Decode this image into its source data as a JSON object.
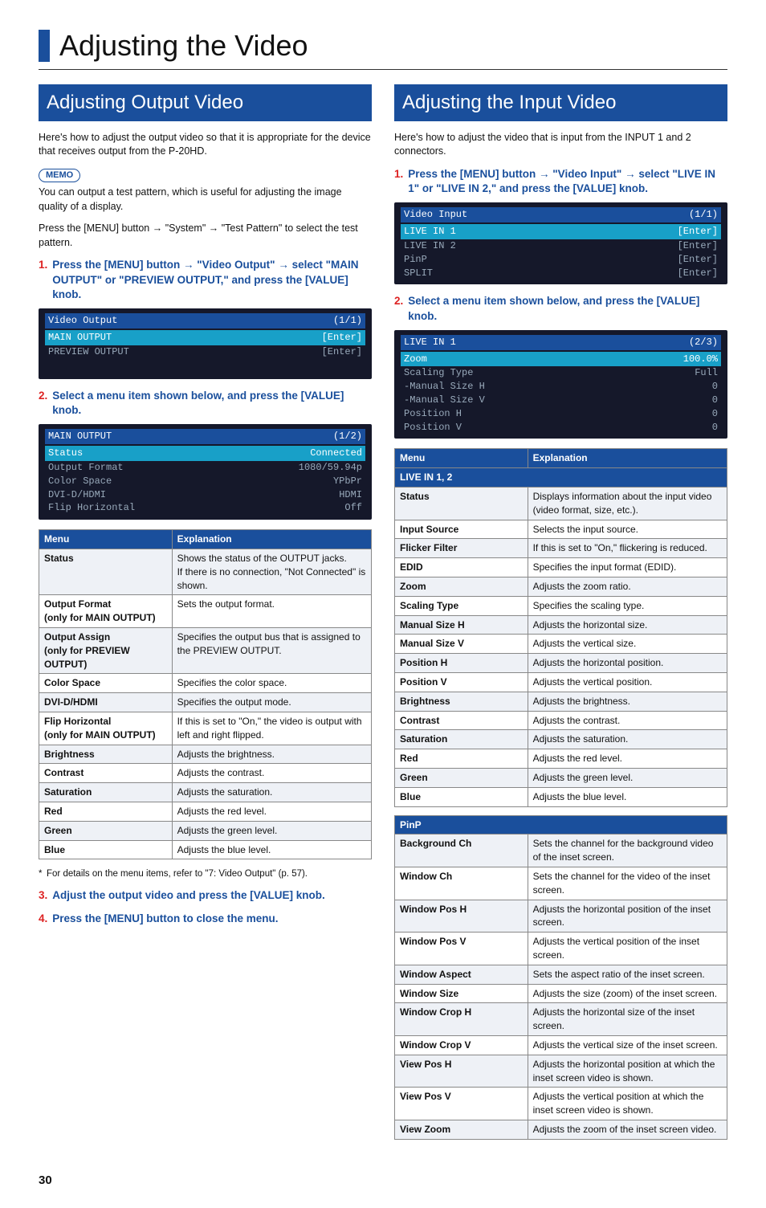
{
  "page": {
    "title": "Adjusting the Video",
    "number": "30"
  },
  "left": {
    "heading": "Adjusting Output Video",
    "intro": "Here's how to adjust the output video so that it is appropriate for the device that receives output from the P-20HD.",
    "memo_label": "MEMO",
    "memo1": "You can output a test pattern, which is useful for adjusting the image quality of a display.",
    "memo2_a": "Press the [MENU] button ",
    "memo2_b": " \"System\" ",
    "memo2_c": " \"Test Pattern\" to select the test pattern.",
    "step1_num": "1.",
    "step1_a": "Press the [MENU] button ",
    "step1_b": " \"Video Output\" ",
    "step1_c": " select \"MAIN OUTPUT\" or \"PREVIEW OUTPUT,\" and press the [VALUE] knob.",
    "osd1": {
      "title_l": "Video Output",
      "title_r": "(1/1)",
      "hl_l": "MAIN OUTPUT",
      "hl_r": "[Enter]",
      "rows": [
        [
          "PREVIEW OUTPUT",
          "[Enter]"
        ]
      ]
    },
    "step2_num": "2.",
    "step2": "Select a menu item shown below, and press the [VALUE] knob.",
    "osd2": {
      "title_l": "MAIN OUTPUT",
      "title_r": "(1/2)",
      "hl_l": "Status",
      "hl_r": "Connected",
      "rows": [
        [
          "Output Format",
          "1080/59.94p"
        ],
        [
          "Color Space",
          "YPbPr"
        ],
        [
          "DVI-D/HDMI",
          "HDMI"
        ],
        [
          "Flip Horizontal",
          "Off"
        ]
      ]
    },
    "table_head_menu": "Menu",
    "table_head_exp": "Explanation",
    "table": [
      {
        "m": "Status",
        "e": "Shows the status of the OUTPUT jacks.\nIf there is no connection, \"Not Connected\" is shown."
      },
      {
        "m": "Output Format\n(only for MAIN OUTPUT)",
        "e": "Sets the output format."
      },
      {
        "m": "Output Assign\n(only for PREVIEW OUTPUT)",
        "e": "Specifies the output bus that is assigned to the PREVIEW OUTPUT."
      },
      {
        "m": "Color Space",
        "e": "Specifies the color space."
      },
      {
        "m": "DVI-D/HDMI",
        "e": "Specifies the output mode."
      },
      {
        "m": "Flip Horizontal\n(only for MAIN OUTPUT)",
        "e": "If this is set to \"On,\" the video is output with left and right flipped."
      },
      {
        "m": "Brightness",
        "e": "Adjusts the brightness."
      },
      {
        "m": "Contrast",
        "e": "Adjusts the contrast."
      },
      {
        "m": "Saturation",
        "e": "Adjusts the saturation."
      },
      {
        "m": "Red",
        "e": "Adjusts the red level."
      },
      {
        "m": "Green",
        "e": "Adjusts the green level."
      },
      {
        "m": "Blue",
        "e": "Adjusts the blue level."
      }
    ],
    "footnote": "For details on the menu items, refer to \"7: Video Output\" (p. 57).",
    "step3_num": "3.",
    "step3": "Adjust the output video and press the [VALUE] knob.",
    "step4_num": "4.",
    "step4": "Press the [MENU] button to close the menu."
  },
  "right": {
    "heading": "Adjusting the Input Video",
    "intro": "Here's how to adjust the video that is input from the INPUT 1 and 2 connectors.",
    "step1_num": "1.",
    "step1_a": "Press the [MENU] button ",
    "step1_b": " \"Video Input\" ",
    "step1_c": " select \"LIVE IN 1\" or \"LIVE IN 2,\" and press the [VALUE] knob.",
    "osd1": {
      "title_l": "Video Input",
      "title_r": "(1/1)",
      "hl_l": "LIVE IN 1",
      "hl_r": "[Enter]",
      "rows": [
        [
          "LIVE IN 2",
          "[Enter]"
        ],
        [
          "PinP",
          "[Enter]"
        ],
        [
          "SPLIT",
          "[Enter]"
        ]
      ]
    },
    "step2_num": "2.",
    "step2": "Select a menu item shown below, and press the [VALUE] knob.",
    "osd2": {
      "title_l": "LIVE IN 1",
      "title_r": "(2/3)",
      "hl_l": "Zoom",
      "hl_r": "100.0%",
      "rows": [
        [
          "Scaling Type",
          "Full"
        ],
        [
          " -Manual Size H",
          "0"
        ],
        [
          " -Manual Size V",
          "0"
        ],
        [
          "Position H",
          "0"
        ],
        [
          "Position V",
          "0"
        ]
      ]
    },
    "table_head_menu": "Menu",
    "table_head_exp": "Explanation",
    "sub1": "LIVE IN 1, 2",
    "table1": [
      {
        "m": "Status",
        "e": "Displays information about the input video (video format, size, etc.)."
      },
      {
        "m": "Input Source",
        "e": "Selects the input source."
      },
      {
        "m": "Flicker Filter",
        "e": "If this is set to \"On,\" flickering is reduced."
      },
      {
        "m": "EDID",
        "e": "Specifies the input format (EDID)."
      },
      {
        "m": "Zoom",
        "e": "Adjusts the zoom ratio."
      },
      {
        "m": "Scaling Type",
        "e": "Specifies the scaling type."
      },
      {
        "m": "Manual Size H",
        "e": "Adjusts the horizontal size.",
        "indent": true
      },
      {
        "m": "Manual Size V",
        "e": "Adjusts the vertical size.",
        "indent": true
      },
      {
        "m": "Position H",
        "e": "Adjusts the horizontal position."
      },
      {
        "m": "Position V",
        "e": "Adjusts the vertical position."
      },
      {
        "m": "Brightness",
        "e": "Adjusts the brightness."
      },
      {
        "m": "Contrast",
        "e": "Adjusts the contrast."
      },
      {
        "m": "Saturation",
        "e": "Adjusts the saturation."
      },
      {
        "m": "Red",
        "e": "Adjusts the red level."
      },
      {
        "m": "Green",
        "e": "Adjusts the green level."
      },
      {
        "m": "Blue",
        "e": "Adjusts the blue level."
      }
    ],
    "sub2": "PinP",
    "table2": [
      {
        "m": "Background Ch",
        "e": "Sets the channel for the background video of the inset screen."
      },
      {
        "m": "Window Ch",
        "e": "Sets the channel for the video of the inset screen."
      },
      {
        "m": "Window Pos H",
        "e": "Adjusts the horizontal position of the inset screen."
      },
      {
        "m": "Window Pos V",
        "e": "Adjusts the vertical position of the inset screen."
      },
      {
        "m": "Window Aspect",
        "e": "Sets the aspect ratio of the inset screen."
      },
      {
        "m": "Window Size",
        "e": "Adjusts the size (zoom) of the inset screen."
      },
      {
        "m": "Window Crop H",
        "e": "Adjusts the horizontal size of the inset screen."
      },
      {
        "m": "Window Crop V",
        "e": "Adjusts the vertical size of the inset screen."
      },
      {
        "m": "View Pos H",
        "e": "Adjusts the horizontal position at which the inset screen video is shown."
      },
      {
        "m": "View Pos V",
        "e": "Adjusts the vertical position at which the inset screen video is shown."
      },
      {
        "m": "View Zoom",
        "e": "Adjusts the zoom of the inset screen video."
      }
    ]
  }
}
